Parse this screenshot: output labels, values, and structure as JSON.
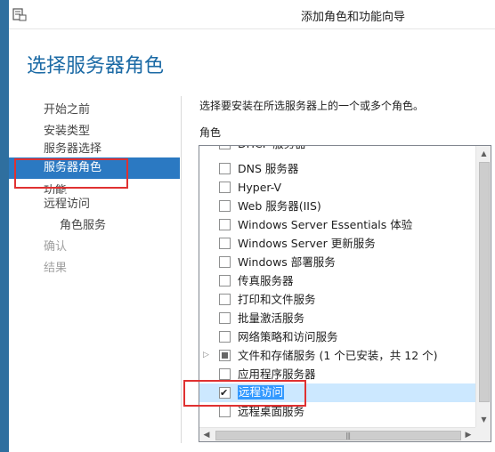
{
  "window": {
    "title": "添加角色和功能向导"
  },
  "page": {
    "title": "选择服务器角色"
  },
  "nav": [
    {
      "label": "开始之前",
      "state": "normal"
    },
    {
      "label": "安装类型",
      "state": "normal"
    },
    {
      "label": "服务器选择",
      "state": "clipped"
    },
    {
      "label": "服务器角色",
      "state": "active"
    },
    {
      "label": "功能",
      "state": "clipped-top"
    },
    {
      "label": "远程访问",
      "state": "normal"
    },
    {
      "label": "角色服务",
      "state": "sub"
    },
    {
      "label": "确认",
      "state": "disabled"
    },
    {
      "label": "结果",
      "state": "disabled"
    }
  ],
  "main": {
    "instruction": "选择要安装在所选服务器上的一个或多个角色。",
    "roles_label": "角色",
    "roles": [
      {
        "label": "DHCP 服务器",
        "checked": false
      },
      {
        "label": "DNS 服务器",
        "checked": false
      },
      {
        "label": "Hyper-V",
        "checked": false
      },
      {
        "label": "Web 服务器(IIS)",
        "checked": false
      },
      {
        "label": "Windows Server Essentials 体验",
        "checked": false
      },
      {
        "label": "Windows Server 更新服务",
        "checked": false
      },
      {
        "label": "Windows 部署服务",
        "checked": false
      },
      {
        "label": "传真服务器",
        "checked": false
      },
      {
        "label": "打印和文件服务",
        "checked": false
      },
      {
        "label": "批量激活服务",
        "checked": false
      },
      {
        "label": "网络策略和访问服务",
        "checked": false
      },
      {
        "label": "文件和存储服务 (1 个已安装，共 12 个)",
        "checked": "partial",
        "expandable": true
      },
      {
        "label": "应用程序服务器",
        "checked": false
      },
      {
        "label": "远程访问",
        "checked": true,
        "selected": true
      },
      {
        "label": "远程桌面服务",
        "checked": false
      }
    ]
  },
  "colors": {
    "title": "#1b6aa5",
    "nav_active": "#2b79c2",
    "selection": "#3399ff",
    "highlight_box": "#e03131"
  },
  "icons": {
    "app": "server-manager-icon",
    "expander": "triangle-right-icon",
    "scroll_up": "arrow-up-icon",
    "scroll_down": "arrow-down-icon",
    "scroll_left": "arrow-left-icon",
    "scroll_right": "arrow-right-icon"
  }
}
